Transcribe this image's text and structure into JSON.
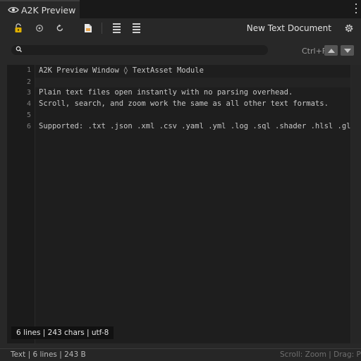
{
  "tab": {
    "title": "A2K Preview"
  },
  "toolbar": {
    "document_title": "New Text Document"
  },
  "search": {
    "placeholder": "",
    "shortcut": "Ctrl+F"
  },
  "editor": {
    "lines": [
      {
        "number": "1",
        "text": "A2K Preview Window ◊ TextAsset Module"
      },
      {
        "number": "2",
        "text": ""
      },
      {
        "number": "3",
        "text": "Plain text files open instantly with no parsing overhead."
      },
      {
        "number": "4",
        "text": "Scroll, search, and zoom work the same as all other text formats."
      },
      {
        "number": "5",
        "text": ""
      },
      {
        "number": "6",
        "text": "Supported: .txt .json .xml .csv .yaml .yml .log .sql .shader .hlsl .gl"
      }
    ]
  },
  "info_badge": "6 lines | 243 chars | utf-8",
  "status": {
    "left": "Text | 6 lines | 243 B",
    "right": "Scroll: Zoom | Drag: Pan"
  },
  "colors": {
    "background": "#282828",
    "editor": "#1e1e1e",
    "lock": "#e0b000",
    "file": "#e8a34a"
  }
}
